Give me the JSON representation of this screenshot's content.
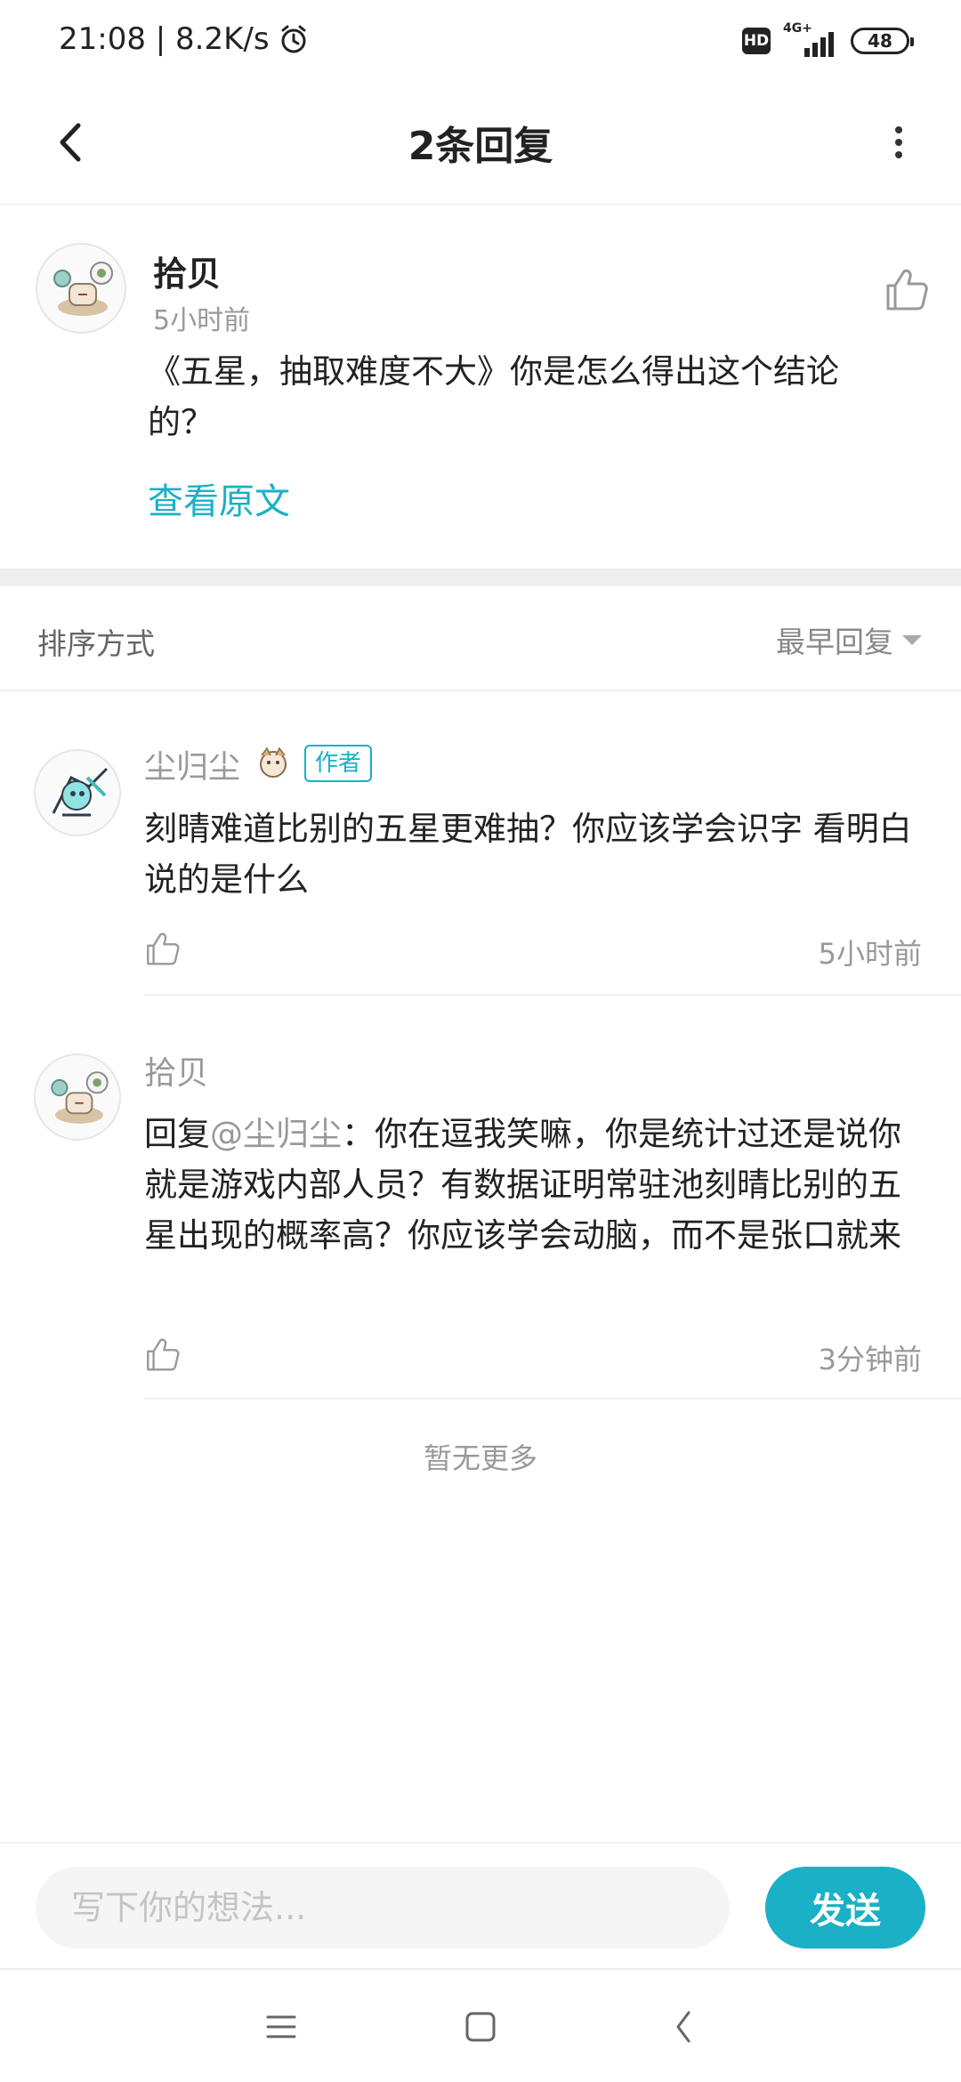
{
  "status_bar": {
    "time_speed": "21:08 | 8.2K/s",
    "hd_label": "HD",
    "network_label": "4G+",
    "battery_level": "48",
    "icons": [
      "alarm-icon",
      "hd-icon",
      "signal-icon",
      "battery-icon"
    ]
  },
  "nav": {
    "title": "2条回复",
    "icons": [
      "back-arrow-icon",
      "more-vertical-icon"
    ]
  },
  "original_comment": {
    "author": "拾贝",
    "time": "5小时前",
    "text": "《五星，抽取难度不大》你是怎么得出这个结论的？",
    "view_original_label": "查看原文"
  },
  "sort": {
    "label": "排序方式",
    "selected": "最早回复"
  },
  "replies": [
    {
      "author": "尘归尘",
      "badge": "作者",
      "text": "刻晴难道比别的五星更难抽？你应该学会识字 看明白说的是什么",
      "time": "5小时前"
    },
    {
      "author": "拾贝",
      "reply_prefix": "回复",
      "mention": "@尘归尘",
      "text": "：你在逗我笑嘛，你是统计过还是说你就是游戏内部人员？有数据证明常驻池刻晴比别的五星出现的概率高？你应该学会动脑，而不是张口就来",
      "time": "3分钟前"
    }
  ],
  "no_more_label": "暂无更多",
  "input": {
    "placeholder": "写下你的想法...",
    "value": "",
    "send_label": "发送"
  },
  "colors": {
    "accent": "#1ab0c6",
    "text_primary": "#222222",
    "text_secondary": "#999999",
    "divider": "#eeeeee"
  }
}
